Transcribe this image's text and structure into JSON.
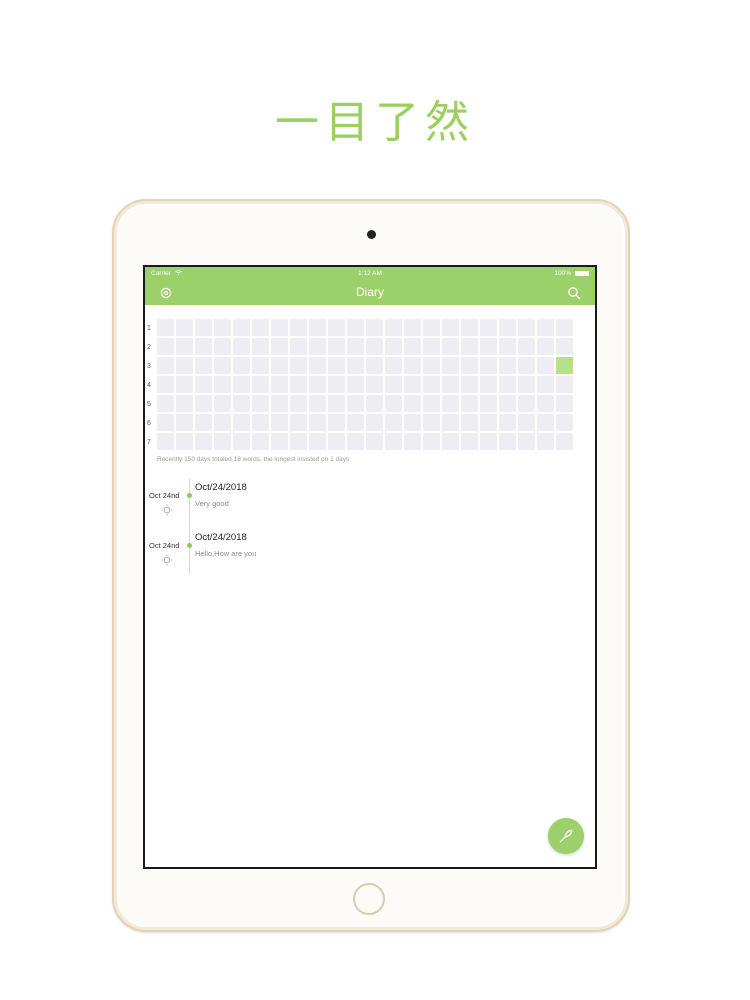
{
  "headline": "一目了然",
  "status_bar": {
    "carrier": "Carrier",
    "time": "1:12 AM",
    "battery": "100%"
  },
  "nav": {
    "title": "Diary",
    "left_icon": "settings-icon",
    "right_icon": "search-icon"
  },
  "heatmap": {
    "row_labels": [
      "1",
      "2",
      "3",
      "4",
      "5",
      "6",
      "7"
    ],
    "columns": 22,
    "active_cells": [
      {
        "row": 3,
        "col": 22
      }
    ],
    "empty_color": "#eeedf3",
    "active_color": "#b6e08a"
  },
  "summary": "Recently 150 days totaled 18 words, the longest insisted on 1 days",
  "entries": [
    {
      "date_label": "Oct 24nd",
      "title": "Oct/24/2018",
      "text": "Very good",
      "weather_icon": "sun-icon"
    },
    {
      "date_label": "Oct 24nd",
      "title": "Oct/24/2018",
      "text": "Hello,How are you",
      "weather_icon": "sun-icon"
    }
  ],
  "fab_icon": "feather-pen-icon",
  "colors": {
    "accent": "#9bd06a",
    "headline": "#9bcf5f",
    "device_frame": "#e3d2b4"
  }
}
